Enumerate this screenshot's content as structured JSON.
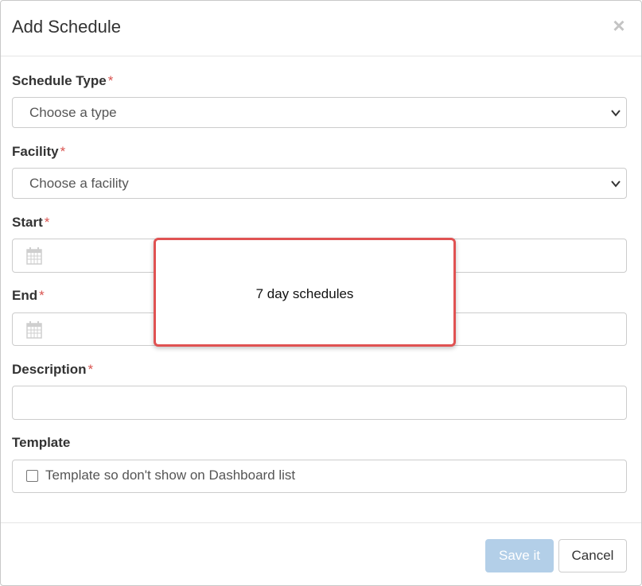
{
  "dialog": {
    "title": "Add Schedule",
    "close_icon": "times-icon"
  },
  "form": {
    "schedule_type": {
      "label": "Schedule Type",
      "required_mark": "*",
      "selected": "Choose a type"
    },
    "facility": {
      "label": "Facility",
      "required_mark": "*",
      "selected": "Choose a facility"
    },
    "start": {
      "label": "Start",
      "required_mark": "*",
      "value": "",
      "icon": "calendar-icon"
    },
    "end": {
      "label": "End",
      "required_mark": "*",
      "value": "",
      "icon": "calendar-icon"
    },
    "description": {
      "label": "Description",
      "required_mark": "*",
      "value": ""
    },
    "template": {
      "label": "Template",
      "checkbox_label": "Template so don't show on Dashboard list",
      "checked": false
    }
  },
  "footer": {
    "save_label": "Save it",
    "cancel_label": "Cancel"
  },
  "popover": {
    "text": "7 day schedules"
  },
  "colors": {
    "required": "#d9534f",
    "save_disabled_bg": "#b3cfe8",
    "popover_border": "#e05252"
  }
}
